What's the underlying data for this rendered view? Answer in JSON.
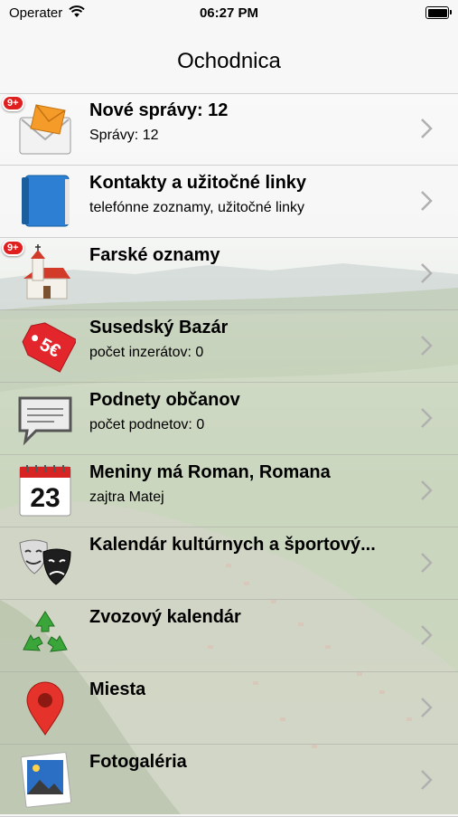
{
  "status": {
    "carrier": "Operater",
    "time": "06:27 PM"
  },
  "nav": {
    "title": "Ochodnica"
  },
  "items": [
    {
      "title": "Nové správy: 12",
      "subtitle": "Správy: 12",
      "icon": "mail-icon",
      "badge": "9+"
    },
    {
      "title": "Kontakty a užitočné linky",
      "subtitle": "telefónne zoznamy, užitočné linky",
      "icon": "address-book-icon"
    },
    {
      "title": "Farské oznamy",
      "subtitle": "",
      "icon": "church-icon",
      "badge": "9+"
    },
    {
      "title": "Susedský Bazár",
      "subtitle": "počet inzerátov: 0",
      "icon": "price-tag-icon",
      "tag_text": "5€"
    },
    {
      "title": "Podnety občanov",
      "subtitle": "počet podnetov: 0",
      "icon": "speech-bubble-icon"
    },
    {
      "title": "Meniny má Roman, Romana",
      "subtitle": "zajtra Matej",
      "icon": "calendar-icon",
      "calendar_day": "23"
    },
    {
      "title": "Kalendár kultúrnych a športový...",
      "subtitle": "",
      "icon": "theater-masks-icon"
    },
    {
      "title": "Zvozový kalendár",
      "subtitle": "",
      "icon": "recycle-icon"
    },
    {
      "title": "Miesta",
      "subtitle": "",
      "icon": "map-pin-icon"
    },
    {
      "title": "Fotogaléria",
      "subtitle": "",
      "icon": "photo-gallery-icon"
    }
  ]
}
